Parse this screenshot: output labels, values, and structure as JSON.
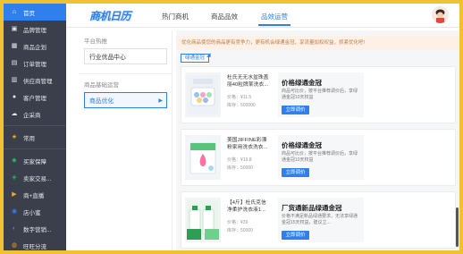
{
  "sidebar": {
    "items": [
      {
        "label": "首页",
        "icon": "home-icon",
        "glyph": "⌂",
        "color": "#ffffff"
      },
      {
        "label": "品牌管理",
        "icon": "brand-icon",
        "glyph": "▣",
        "color": "#e3e6ea"
      },
      {
        "label": "商品企划",
        "icon": "grid-icon",
        "glyph": "▦",
        "color": "#e3e6ea"
      },
      {
        "label": "订单管理",
        "icon": "order-icon",
        "glyph": "▤",
        "color": "#e3e6ea"
      },
      {
        "label": "供应商管理",
        "icon": "supplier-icon",
        "glyph": "▥",
        "color": "#e3e6ea"
      },
      {
        "label": "客户管理",
        "icon": "person-icon",
        "glyph": "●",
        "color": "#e3e6ea"
      },
      {
        "label": "企采商",
        "icon": "cloud-icon",
        "glyph": "☁",
        "color": "#e3e6ea"
      },
      {
        "label": "常用",
        "icon": "star-icon",
        "glyph": "★",
        "color": "#f5a623"
      },
      {
        "label": "买家保障",
        "icon": "shield-icon",
        "glyph": "◆",
        "color": "#27ae60"
      },
      {
        "label": "卖家交易...",
        "icon": "trade-icon",
        "glyph": "◈",
        "color": "#27ae60"
      },
      {
        "label": "商+直播",
        "icon": "live-icon",
        "glyph": "▶",
        "color": "#f5a623"
      },
      {
        "label": "店小蜜",
        "icon": "bot-icon",
        "glyph": "◉",
        "color": "#2f80ed"
      },
      {
        "label": "数字营销...",
        "icon": "marketing-icon",
        "glyph": "◐",
        "color": "#2f80ed"
      },
      {
        "label": "旺旺分流",
        "icon": "chat-icon",
        "glyph": "◍",
        "color": "#f39c12"
      }
    ]
  },
  "header": {
    "logo": "商机日历",
    "tabs": [
      "热门商机",
      "商品品效",
      "品效运营"
    ],
    "active_tab": "品效运营"
  },
  "left_menu": {
    "section1": "平台热推",
    "item1": "行业优品中心",
    "section2": "商品基础运营",
    "item2": "商品优化",
    "item2_arrow": "▶"
  },
  "main": {
    "notice": "优化商品使您的商品更有竞争力，更有机会绿通金冠，享流量加权权益，抓紧优化吧!",
    "tag": "绿通金冠",
    "cards": [
      {
        "title": "杜氏无无水盆珠盖丽40粒牌某洗衣...",
        "price_label": "价格：",
        "price": "¥11.5",
        "stock_label": "库存：",
        "stock": "500000",
        "offer_title": "价格绿通金冠",
        "offer_desc": "商品可比价，按平台推荐调价后，享绿通金冠10天权益",
        "button": "立即调价"
      },
      {
        "title": "美国JIFFINE彩漂粉家用洗衣洗衣...",
        "price_label": "价格：",
        "price": "¥19.8",
        "stock_label": "库存：",
        "stock": "50000",
        "offer_title": "价格绿通金冠",
        "offer_desc": "商品可比价，按平台推荐调价后，享绿通金冠10天权益",
        "button": "立即调价"
      },
      {
        "title": "【4斤】杜氏克信净柔护洗衣液1...",
        "price_label": "价格：",
        "price": "¥39",
        "stock_label": "库存：",
        "stock": "50000",
        "offer_title": "厂货通新品绿通金冠",
        "offer_desc": "价格不满足新品绿通要求，无法享绿通金冠15天权益，建议立...",
        "button": "立即调价"
      }
    ]
  },
  "colors": {
    "accent": "#2f80ed",
    "sidebar_bg": "#3a3f4b",
    "notice_bg": "#fdf1e7",
    "border": "#f0c233"
  }
}
